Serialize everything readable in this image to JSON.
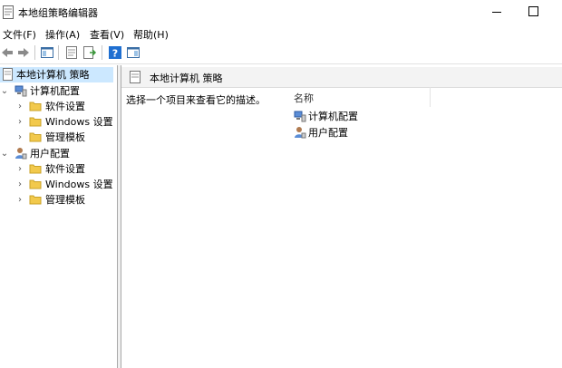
{
  "window": {
    "title": "本地组策略编辑器",
    "icon": "policy-editor-icon"
  },
  "menu": [
    "文件(F)",
    "操作(A)",
    "查看(V)",
    "帮助(H)"
  ],
  "toolbar": {
    "buttons": [
      "back-icon",
      "forward-icon",
      "show-hide-console-tree-icon",
      "properties-icon",
      "export-list-icon",
      "help-icon",
      "show-hide-action-pane-icon"
    ]
  },
  "tree": {
    "root": "本地计算机 策略",
    "computer_config": "计算机配置",
    "user_config": "用户配置",
    "computer_children": [
      "软件设置",
      "Windows 设置",
      "管理模板"
    ],
    "user_children": [
      "软件设置",
      "Windows 设置",
      "管理模板"
    ]
  },
  "right_pane": {
    "header": "本地计算机 策略",
    "description": "选择一个项目来查看它的描述。",
    "column_name": "名称",
    "items": [
      "计算机配置",
      "用户配置"
    ]
  },
  "colors": {
    "selection": "#cce8ff",
    "folder": "#f2c94c",
    "help_blue": "#1f6fd1"
  }
}
